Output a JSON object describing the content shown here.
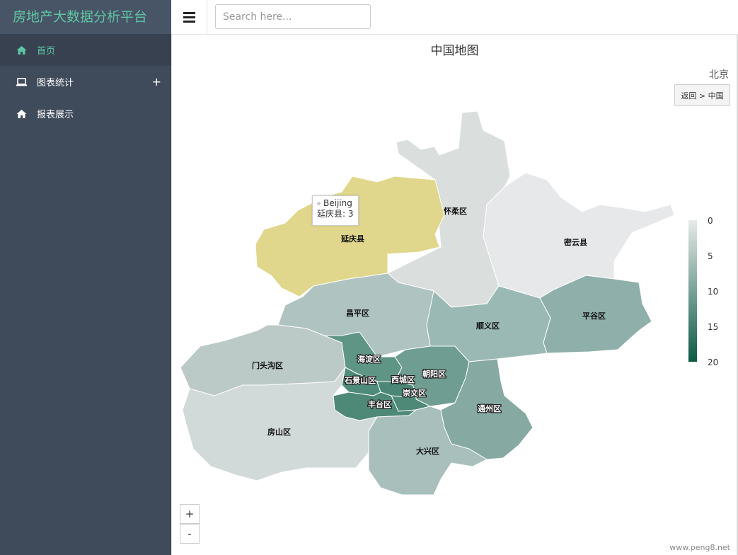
{
  "app": {
    "brand": "房地产大数据分析平台"
  },
  "sidebar": {
    "items": [
      {
        "label": "首页",
        "icon": "home-icon",
        "active": true
      },
      {
        "label": "图表统计",
        "icon": "laptop-icon",
        "expandable": true,
        "expand_symbol": "+"
      },
      {
        "label": "报表展示",
        "icon": "home-icon"
      }
    ]
  },
  "search": {
    "placeholder": "Search here..."
  },
  "map": {
    "title": "中国地图",
    "region": "北京",
    "back_label": "返回 > 中国",
    "tooltip": {
      "series": "Beijing",
      "text": "延庆县: 3"
    },
    "legend": {
      "labels": [
        "0",
        "5",
        "10",
        "15",
        "20"
      ]
    },
    "zoom_in": "+",
    "zoom_out": "-",
    "districts": [
      {
        "name": "延庆县",
        "value": 3,
        "color": "#e0d78c"
      },
      {
        "name": "怀柔区",
        "value": 0,
        "color": "#dadfde"
      },
      {
        "name": "密云县",
        "value": 0,
        "color": "#e6e8e9"
      },
      {
        "name": "昌平区",
        "value": 6,
        "color": "#afc3c0"
      },
      {
        "name": "顺义区",
        "value": 8,
        "color": "#9ab9b4"
      },
      {
        "name": "平谷区",
        "value": 9,
        "color": "#8fb0aa"
      },
      {
        "name": "门头沟区",
        "value": 5,
        "color": "#bbc9c7"
      },
      {
        "name": "海淀区",
        "value": 15,
        "color": "#5f9585"
      },
      {
        "name": "石景山区",
        "value": 16,
        "color": "#4f8b7a"
      },
      {
        "name": "西城区",
        "value": 17,
        "color": "#4b8676"
      },
      {
        "name": "朝阳区",
        "value": 13,
        "color": "#6f9d91"
      },
      {
        "name": "崇文区",
        "value": 16,
        "color": "#4e8877"
      },
      {
        "name": "丰台区",
        "value": 16,
        "color": "#4e8877"
      },
      {
        "name": "通州区",
        "value": 11,
        "color": "#86aaa2"
      },
      {
        "name": "房山区",
        "value": 3,
        "color": "#d2dad9"
      },
      {
        "name": "大兴区",
        "value": 7,
        "color": "#a8bfbc"
      }
    ]
  },
  "watermark": "www.peng8.net"
}
